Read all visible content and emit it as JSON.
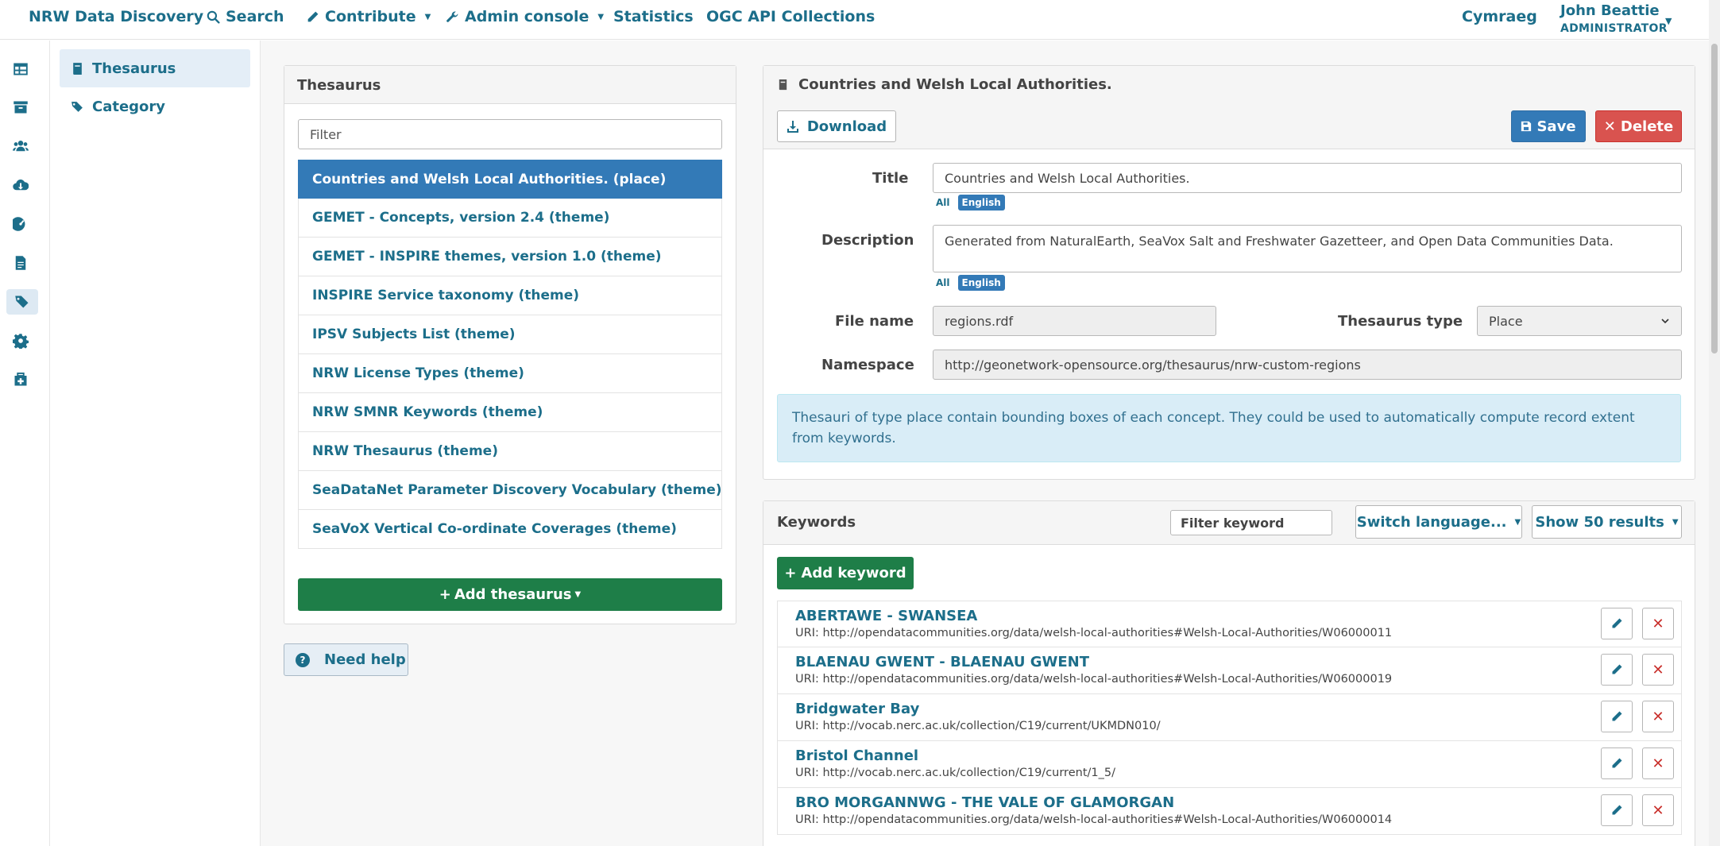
{
  "nav": {
    "brand": "NRW Data Discovery",
    "search": "Search",
    "contribute": "Contribute",
    "admin": "Admin console",
    "statistics": "Statistics",
    "ogc": "OGC API Collections",
    "language": "Cymraeg",
    "user_name": "John Beattie",
    "user_role": "ADMINISTRATOR"
  },
  "rail_icons": [
    "table-icon",
    "archive-icon",
    "users-icon",
    "cloud-download-icon",
    "dashboard-icon",
    "file-icon",
    "tags-icon",
    "gear-icon",
    "medkit-icon"
  ],
  "subnav": {
    "thesaurus": "Thesaurus",
    "category": "Category"
  },
  "thesaurus_panel": {
    "heading": "Thesaurus",
    "filter_placeholder": "Filter",
    "items": [
      "Countries and Welsh Local Authorities. (place)",
      "GEMET - Concepts, version 2.4 (theme)",
      "GEMET - INSPIRE themes, version 1.0 (theme)",
      "INSPIRE Service taxonomy (theme)",
      "IPSV Subjects List (theme)",
      "NRW License Types (theme)",
      "NRW SMNR Keywords (theme)",
      "NRW Thesaurus (theme)",
      "SeaDataNet Parameter Discovery Vocabulary (theme)",
      "SeaVoX Vertical Co-ordinate Coverages (theme)"
    ],
    "add_button": "Add thesaurus"
  },
  "need_help": "Need help",
  "detail": {
    "heading": "Countries and Welsh Local Authorities.",
    "download": "Download",
    "save": "Save",
    "delete": "Delete",
    "title_label": "Title",
    "title_value": "Countries and Welsh Local Authorities.",
    "description_label": "Description",
    "description_value": "Generated from NaturalEarth, SeaVox Salt and Freshwater Gazetteer, and Open Data Communities Data.",
    "lang_all": "All",
    "lang_english": "English",
    "filename_label": "File name",
    "filename_value": "regions.rdf",
    "type_label": "Thesaurus type",
    "type_value": "Place",
    "namespace_label": "Namespace",
    "namespace_value": "http://geonetwork-opensource.org/thesaurus/nrw-custom-regions",
    "info": "Thesauri of type place contain bounding boxes of each concept. They could be used to automatically compute record extent from keywords."
  },
  "keywords": {
    "heading": "Keywords",
    "filter_placeholder": "Filter keyword",
    "switch_language": "Switch language...",
    "show_results": "Show 50 results",
    "add_keyword": "Add keyword",
    "items": [
      {
        "name": "ABERTAWE - SWANSEA",
        "uri": "URI: http://opendatacommunities.org/data/welsh-local-authorities#Welsh-Local-Authorities/W06000011"
      },
      {
        "name": "BLAENAU GWENT - BLAENAU GWENT",
        "uri": "URI: http://opendatacommunities.org/data/welsh-local-authorities#Welsh-Local-Authorities/W06000019"
      },
      {
        "name": "Bridgwater Bay",
        "uri": "URI: http://vocab.nerc.ac.uk/collection/C19/current/UKMDN010/"
      },
      {
        "name": "Bristol Channel",
        "uri": "URI: http://vocab.nerc.ac.uk/collection/C19/current/1_5/"
      },
      {
        "name": "BRO MORGANNWG - THE VALE OF GLAMORGAN",
        "uri": "URI: http://opendatacommunities.org/data/welsh-local-authorities#Welsh-Local-Authorities/W06000014"
      }
    ]
  }
}
